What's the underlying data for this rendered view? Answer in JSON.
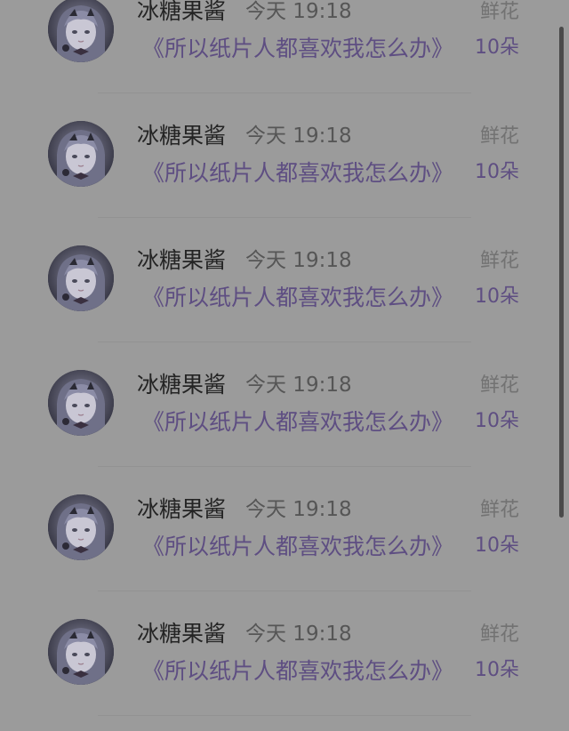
{
  "records": [
    {
      "user": "冰糖果酱",
      "time": "今天 19:18",
      "title": "《所以纸片人都喜欢我怎么办》",
      "gift": "鲜花",
      "count": "10朵"
    },
    {
      "user": "冰糖果酱",
      "time": "今天 19:18",
      "title": "《所以纸片人都喜欢我怎么办》",
      "gift": "鲜花",
      "count": "10朵"
    },
    {
      "user": "冰糖果酱",
      "time": "今天 19:18",
      "title": "《所以纸片人都喜欢我怎么办》",
      "gift": "鲜花",
      "count": "10朵"
    },
    {
      "user": "冰糖果酱",
      "time": "今天 19:18",
      "title": "《所以纸片人都喜欢我怎么办》",
      "gift": "鲜花",
      "count": "10朵"
    },
    {
      "user": "冰糖果酱",
      "time": "今天 19:18",
      "title": "《所以纸片人都喜欢我怎么办》",
      "gift": "鲜花",
      "count": "10朵"
    },
    {
      "user": "冰糖果酱",
      "time": "今天 19:18",
      "title": "《所以纸片人都喜欢我怎么办》",
      "gift": "鲜花",
      "count": "10朵"
    }
  ],
  "colors": {
    "background": "#9b9b9b",
    "accent": "#5e4e82",
    "name": "#242424",
    "muted": "#727272"
  }
}
